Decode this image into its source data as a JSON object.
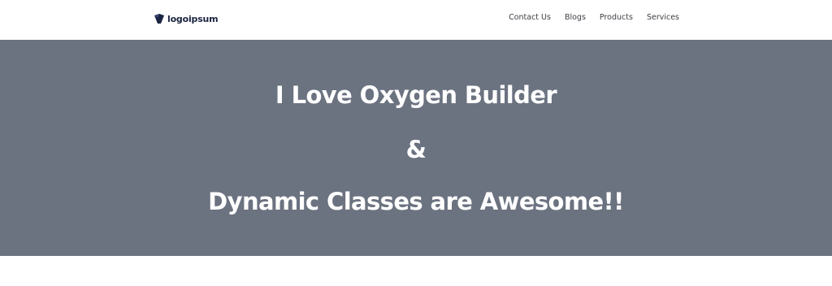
{
  "header": {
    "logo_text": "logoipsum",
    "logo_mark": "®",
    "nav": [
      {
        "label": "Contact Us"
      },
      {
        "label": "Blogs"
      },
      {
        "label": "Products"
      },
      {
        "label": "Services"
      }
    ]
  },
  "hero": {
    "line1": "I Love Oxygen Builder",
    "line2": "&",
    "line3": "Dynamic Classes are Awesome!!"
  },
  "colors": {
    "hero_bg": "#6b7280",
    "logo_navy": "#1b2440",
    "nav_text": "#3c3f45"
  }
}
